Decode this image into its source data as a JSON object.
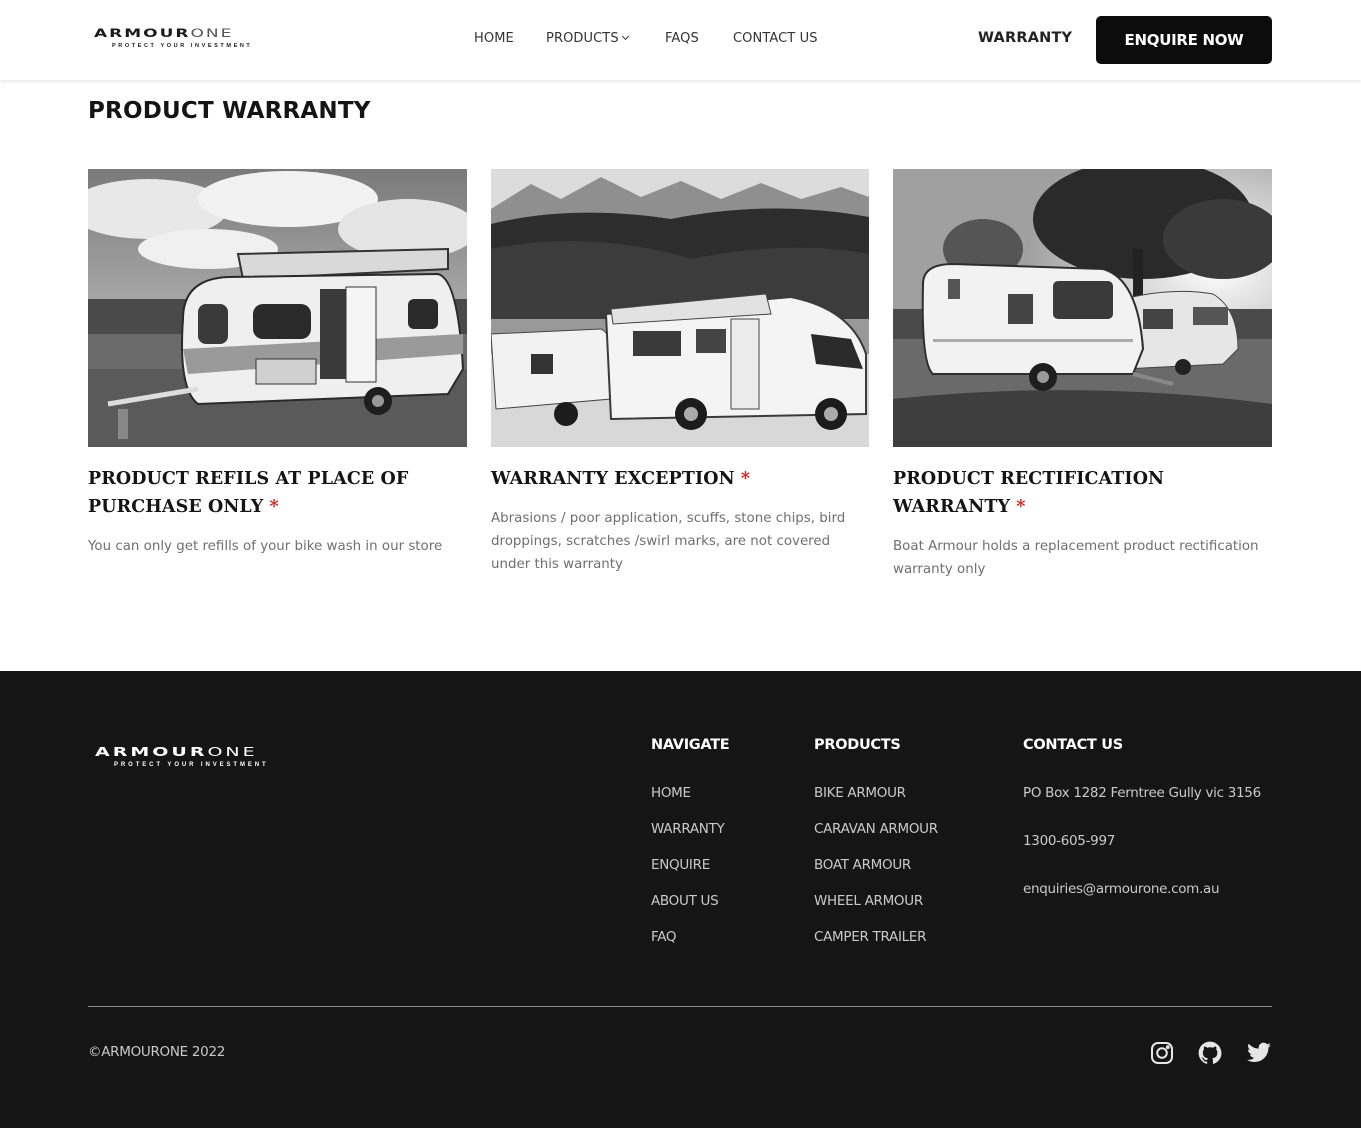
{
  "header": {
    "logo_text_bold": "ARMOUR",
    "logo_text_thin": "ONE",
    "logo_tagline": "PROTECT YOUR INVESTMENT",
    "nav": [
      {
        "label": "HOME"
      },
      {
        "label": "PRODUCTS",
        "has_dropdown": true
      },
      {
        "label": "FAQS"
      },
      {
        "label": "CONTACT US"
      }
    ],
    "warranty_label": "WARRANTY",
    "enquire_label": "ENQUIRE NOW"
  },
  "main": {
    "title": "PRODUCT WARRANTY",
    "cards": [
      {
        "title": "PRODUCT REFILS AT PLACE OF PURCHASE ONLY",
        "asterisk": "*",
        "text": "You can only get refills of your bike wash in our store",
        "image": "caravan-popup-top-photo"
      },
      {
        "title": "WARRANTY EXCEPTION",
        "asterisk": "*",
        "text": "Abrasions / poor application, scuffs, stone chips, bird droppings, scratches /swirl marks, are not covered under this warranty",
        "image": "motorhome-mountains-photo"
      },
      {
        "title": "PRODUCT RECTIFICATION WARRANTY",
        "asterisk": "*",
        "text": "Boat Armour holds a replacement product rectification warranty only",
        "image": "caravans-under-tree-photo"
      }
    ]
  },
  "footer": {
    "logo_text_bold": "ARMOUR",
    "logo_text_thin": "ONE",
    "logo_tagline": "PROTECT YOUR INVESTMENT",
    "navigate": {
      "heading": "NAVIGATE",
      "items": [
        "HOME",
        "WARRANTY",
        "ENQUIRE",
        "ABOUT US",
        "FAQ"
      ]
    },
    "products": {
      "heading": "PRODUCTS",
      "items": [
        "BIKE ARMOUR",
        "CARAVAN ARMOUR",
        "BOAT ARMOUR",
        "WHEEL ARMOUR",
        "CAMPER TRAILER"
      ]
    },
    "contact": {
      "heading": "CONTACT US",
      "address": "PO Box 1282 Ferntree Gully vic 3156",
      "phone": "1300-605-997",
      "email": "enquiries@armourone.com.au"
    },
    "copyright": "©ARMOURONE 2022",
    "social_icons": [
      "instagram-icon",
      "github-icon",
      "twitter-icon"
    ]
  },
  "colors": {
    "footer_bg": "#151515",
    "button_bg": "#0c0c0c",
    "asterisk": "#d32020",
    "body_text": "#6f6f6f"
  }
}
